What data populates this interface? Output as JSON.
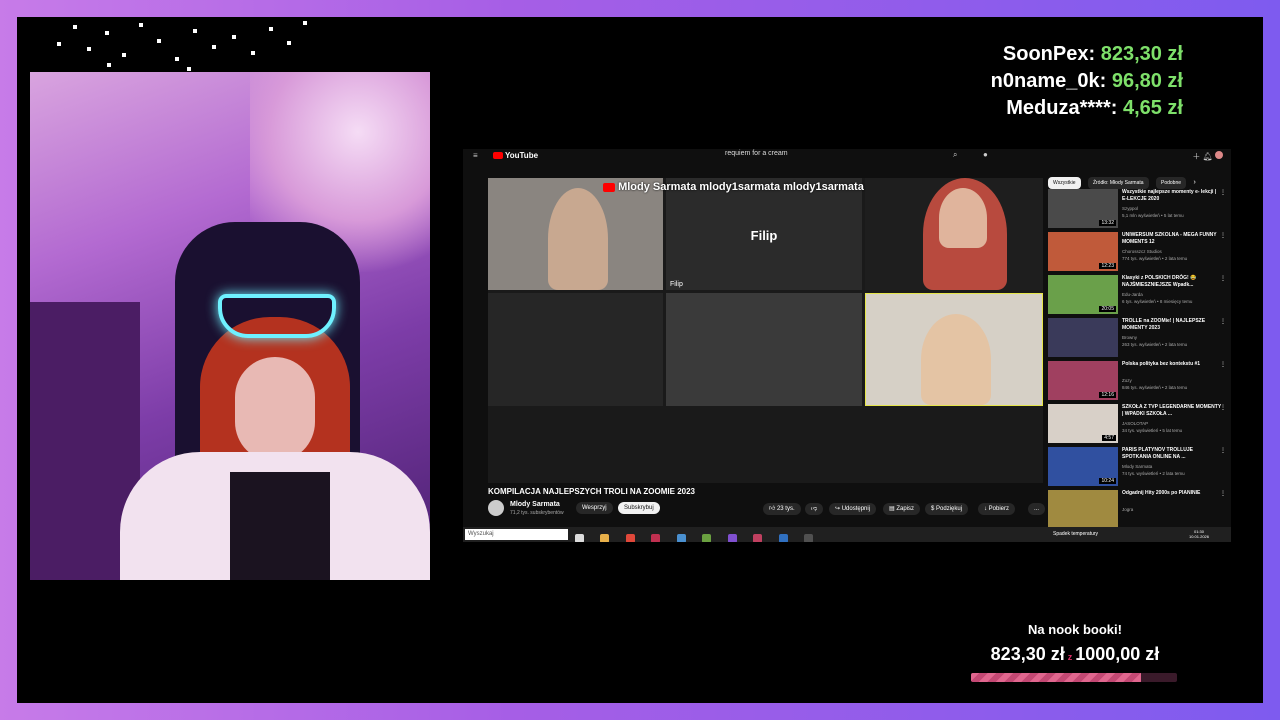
{
  "donations": [
    {
      "name": "SoonPex:",
      "amount": "823,30 zł"
    },
    {
      "name": "n0name_0k:",
      "amount": "96,80 zł"
    },
    {
      "name": "Meduza****:",
      "amount": "4,65 zł"
    }
  ],
  "youtube": {
    "logo": "YouTube",
    "search_query": "requiem for a cream",
    "video_overlay_credits": "Mlody Sarmata   mlody1sarmata   mlody1sarmata",
    "tile_name": "Filip",
    "video_title": "KOMPILACJA NAJLEPSZYCH TROLI NA ZOOMIE 2023",
    "channel_name": "Mlody Sarmata",
    "channel_subs": "71,2 tys. subskrybentów",
    "support_label": "Wesprzyj",
    "subscribe_label": "Subskrybuj",
    "likes_label": "23 tys.",
    "share_label": "Udostępnij",
    "save_label": "Zapisz",
    "thanks_label": "Podziękuj",
    "download_label": "Pobierz",
    "more_label": "...",
    "chips": [
      "Wszystkie",
      "Źródło: Młody Sarmata",
      "Podobne"
    ],
    "recommendations": [
      {
        "title": "Wszystkie najlepsze momenty e- lekcji | E-LEKCJE 2020",
        "channel": "Szyppol",
        "meta": "5,1 mln wyświetleń • 5 lat temu",
        "duration": "13:32"
      },
      {
        "title": "UNIWERSUM SZKOLNA - MEGA FUNNY MOMENTS 12",
        "channel": "Chorosszcz Studios",
        "meta": "774 tys. wyświetleń • 2 lata temu",
        "duration": "12:23"
      },
      {
        "title": "Klasyki z POLSKICH DRÓG! 😂 NAJŚMIESZNIEJSZE Wpadk...",
        "channel": "Edu-Jarda",
        "meta": "6 tys. wyświetleń • 8 miesięcy temu",
        "duration": "20:05"
      },
      {
        "title": "TROLLE na ZOOMie! | NAJLEPSZE MOMENTY 2023",
        "channel": "Browny",
        "meta": "263 tys. wyświetleń • 2 lata temu",
        "duration": ""
      },
      {
        "title": "Polska polityka bez kontekstu #1",
        "channel": "Zozy",
        "meta": "846 tys. wyświetleń • 2 lata temu",
        "duration": "12:16"
      },
      {
        "title": "SZKOŁA Z TVP LEGENDARNE MOMENTY | WPADKI SZKOŁA ...",
        "channel": "JASOLOTAP",
        "meta": "34 tys. wyświetleń • 5 lat temu",
        "duration": "4:57"
      },
      {
        "title": "PARIS PLATYNOV TROLLUJE SPOTKANIA ONLINE NA ...",
        "channel": "Mlody Sarmata",
        "meta": "74 tys. wyświetleń • 2 lata temu",
        "duration": "10:24"
      },
      {
        "title": "Odgadnij Hity 2000s po PIANINIE",
        "channel": "Jogra",
        "meta": "",
        "duration": ""
      }
    ]
  },
  "taskbar": {
    "search_placeholder": "Wyszukaj",
    "weather": "Spadek temperatury",
    "time": "01:30",
    "date": "10.01.2026"
  },
  "goal": {
    "label": "Na nook booki!",
    "current": "823,30 zł",
    "separator": "z",
    "target": "1000,00 zł",
    "progress": 0.823
  },
  "colors": {
    "donation_amount": "#7ee06a",
    "goal_fill": "#e0668e",
    "frame": "#a65ee6"
  }
}
